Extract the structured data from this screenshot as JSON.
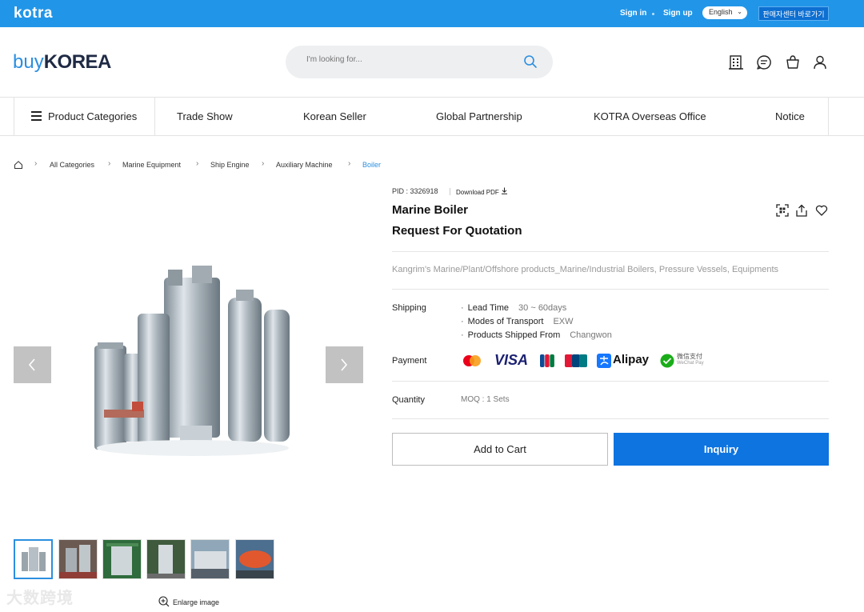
{
  "topbar": {
    "logo": "kotra",
    "sign_in": "Sign in",
    "sign_up": "Sign up",
    "language": "English",
    "seller_center": "판매자센터 바로가기"
  },
  "header": {
    "brand_buy": "buy",
    "brand_korea": "KOREA",
    "search_placeholder": "I'm looking for...",
    "icons": [
      "company-icon",
      "chat-icon",
      "cart-icon",
      "user-icon"
    ]
  },
  "nav": {
    "categories": "Product Categories",
    "items": [
      "Trade Show",
      "Korean Seller",
      "Global Partnership",
      "KOTRA Overseas Office",
      "Notice"
    ]
  },
  "breadcrumb": [
    "All Categories",
    "Marine Equipment",
    "Ship Engine",
    "Auxiliary Machine",
    "Boiler"
  ],
  "gallery": {
    "enlarge": "Enlarge image",
    "thumb_count": 6,
    "watermark": "大数跨境"
  },
  "product": {
    "pid": "PID : 3326918",
    "download_pdf": "Download PDF",
    "title": "Marine Boiler",
    "subtitle": "Request For Quotation",
    "description": "Kangrim's Marine/Plant/Offshore products_Marine/Industrial Boilers, Pressure Vessels, Equipments",
    "shipping_label": "Shipping",
    "shipping": [
      {
        "name": "Lead Time",
        "value": "30 ~ 60days"
      },
      {
        "name": "Modes of Transport",
        "value": "EXW"
      },
      {
        "name": "Products Shipped From",
        "value": "Changwon"
      }
    ],
    "payment_label": "Payment",
    "payments": {
      "visa": "VISA",
      "alipay": "Alipay",
      "wechat": "微信支付",
      "wechat_sub": "WeChat Pay"
    },
    "quantity_label": "Quantity",
    "moq": "MOQ : 1 Sets",
    "add_to_cart": "Add to Cart",
    "inquiry": "Inquiry"
  },
  "colors": {
    "topbar": "#2196e8",
    "primary_button": "#0d74e0",
    "breadcrumb_active": "#2b8fe0"
  }
}
